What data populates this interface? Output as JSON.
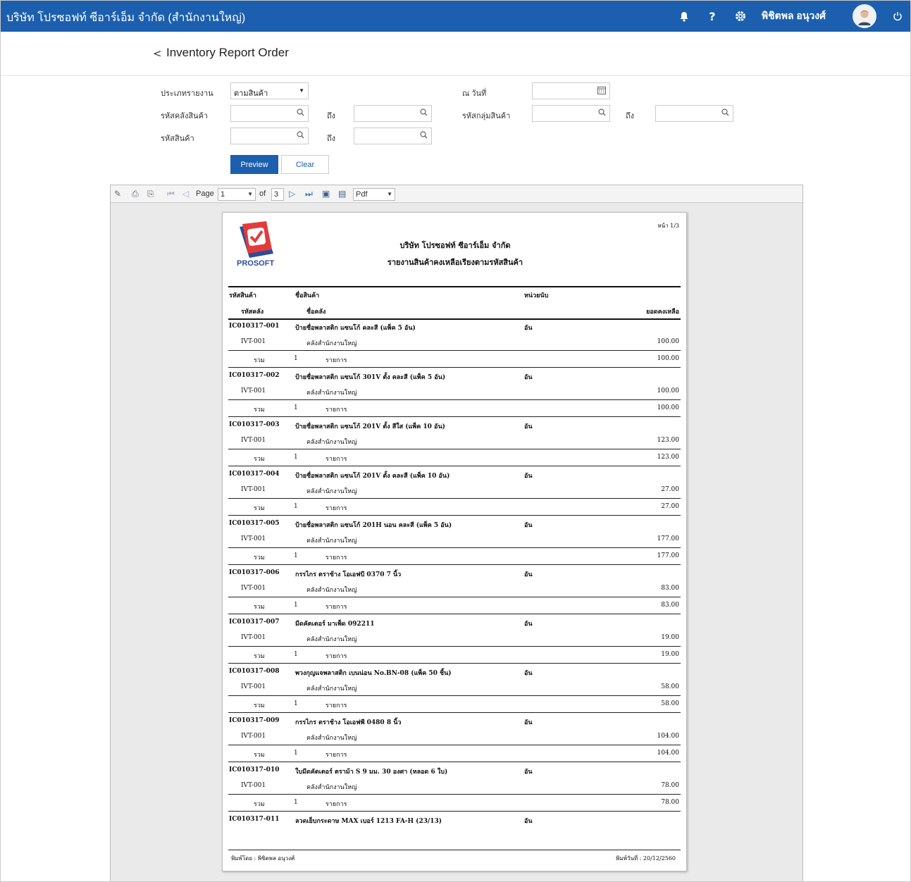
{
  "app": {
    "title": "บริษัท โปรซอฟท์ ซีอาร์เอ็ม จำกัด (สำนักงานใหญ่)",
    "user_name": "พิชิตพล อนุวงศ์",
    "accent_color": "#1c5fae",
    "icons": [
      "bell-icon",
      "help-icon",
      "settings-icon",
      "avatar",
      "power-icon"
    ]
  },
  "page": {
    "back_symbol": "<",
    "title": "Inventory Report Order"
  },
  "form": {
    "report_type_label": "ประเภทรายงาน",
    "report_type_value": "ตามสินค้า",
    "as_of_date_label": "ณ วันที่",
    "warehouse_code_label": "รหัสคลังสินค้า",
    "to_label": "ถึง",
    "product_group_label": "รหัสกลุ่มสินค้า",
    "product_code_label": "รหัสสินค้า",
    "preview_label": "Preview",
    "clear_label": "Clear"
  },
  "viewer": {
    "page_label": "Page",
    "page_value": "1",
    "of_label": "of",
    "total_pages": "3",
    "format_value": "Pdf"
  },
  "report": {
    "page_no": "หน้า 1/3",
    "logo_text": "PROSOFT",
    "company": "บริษัท โปรซอฟท์ ซีอาร์เอ็ม จำกัด",
    "title": "รายงานสินค้าคงเหลือเรียงตามรหัสสินค้า",
    "headers": {
      "code": "รหัสสินค้า",
      "name": "ชื่อสินค้า",
      "unit": "หน่วยนับ",
      "wh_code": "รหัสคลัง",
      "wh_name": "ชื่อคลัง",
      "balance": "ยอดคงเหลือ"
    },
    "total_label": "รวม",
    "items_label": "รายการ",
    "rows": [
      {
        "code": "IC010317-001",
        "name": "ป้ายชื่อพลาสติก แซนโก้ คละสี (แพ็ค 5 อัน)",
        "unit": "อัน",
        "wh": "IVT-001",
        "wh_name": "คลังสำนักงานใหญ่",
        "qty": "100.00",
        "count": "1",
        "total": "100.00"
      },
      {
        "code": "IC010317-002",
        "name": "ป้ายชื่อพลาสติก แซนโก้ 301V ตั้ง คละสี (แพ็ค 5 อัน)",
        "unit": "อัน",
        "wh": "IVT-001",
        "wh_name": "คลังสำนักงานใหญ่",
        "qty": "100.00",
        "count": "1",
        "total": "100.00"
      },
      {
        "code": "IC010317-003",
        "name": "ป้ายชื่อพลาสติก แซนโก้ 201V ตั้ง สีใส (แพ็ค 10 อัน)",
        "unit": "อัน",
        "wh": "IVT-001",
        "wh_name": "คลังสำนักงานใหญ่",
        "qty": "123.00",
        "count": "1",
        "total": "123.00"
      },
      {
        "code": "IC010317-004",
        "name": "ป้ายชื่อพลาสติก แซนโก้ 201V ตั้ง คละสี (แพ็ค 10 อัน)",
        "unit": "อัน",
        "wh": "IVT-001",
        "wh_name": "คลังสำนักงานใหญ่",
        "qty": "27.00",
        "count": "1",
        "total": "27.00"
      },
      {
        "code": "IC010317-005",
        "name": "ป้ายชื่อพลาสติก แซนโก้ 201H นอน คละสี (แพ็ค 5 อัน)",
        "unit": "อัน",
        "wh": "IVT-001",
        "wh_name": "คลังสำนักงานใหญ่",
        "qty": "177.00",
        "count": "1",
        "total": "177.00"
      },
      {
        "code": "IC010317-006",
        "name": "กรรไกร ตราช้าง โอเอฟบี 0370 7 นิ้ว",
        "unit": "อัน",
        "wh": "IVT-001",
        "wh_name": "คลังสำนักงานใหญ่",
        "qty": "83.00",
        "count": "1",
        "total": "83.00"
      },
      {
        "code": "IC010317-007",
        "name": "มีดคัตเตอร์ มาเพ็ด 092211",
        "unit": "อัน",
        "wh": "IVT-001",
        "wh_name": "คลังสำนักงานใหญ่",
        "qty": "19.00",
        "count": "1",
        "total": "19.00"
      },
      {
        "code": "IC010317-008",
        "name": "พวงกุญแจพลาสติก เบนน่อน No.BN-08 (แพ็ค 50 ชิ้น)",
        "unit": "อัน",
        "wh": "IVT-001",
        "wh_name": "คลังสำนักงานใหญ่",
        "qty": "58.00",
        "count": "1",
        "total": "58.00"
      },
      {
        "code": "IC010317-009",
        "name": "กรรไกร ตราช้าง โอเอฟพี 0480 8 นิ้ว",
        "unit": "อัน",
        "wh": "IVT-001",
        "wh_name": "คลังสำนักงานใหญ่",
        "qty": "104.00",
        "count": "1",
        "total": "104.00"
      },
      {
        "code": "IC010317-010",
        "name": "ใบมีดคัตเตอร์ ตราม้า S 9 มม. 30 องศา (หลอด 6 ใบ)",
        "unit": "อัน",
        "wh": "IVT-001",
        "wh_name": "คลังสำนักงานใหญ่",
        "qty": "78.00",
        "count": "1",
        "total": "78.00"
      }
    ],
    "last_row": {
      "code": "IC010317-011",
      "name": "ลวดเย็บกระดาษ MAX เบอร์ 1213 FA-H (23/13)",
      "unit": "อัน"
    },
    "printed_by": "พิมพ์โดย : พิชิตพล อนุวงศ์",
    "printed_date": "พิมพ์วันที่ : 20/12/2560"
  }
}
